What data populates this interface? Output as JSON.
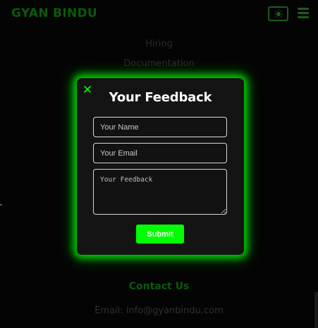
{
  "colors": {
    "accent": "#00ff00",
    "dim_accent": "#0a5a0a",
    "modal_bg": "#141414",
    "page_bg": "#040404"
  },
  "header": {
    "logo_text": "GYAN BINDU",
    "theme_toggle_icon": "sun-icon",
    "menu_icon": "hamburger-icon"
  },
  "nav": {
    "items": [
      "Hiring",
      "Documentation"
    ]
  },
  "modal": {
    "close_icon": "close-icon",
    "close_symbol": "✕",
    "title": "Your Feedback",
    "name_placeholder": "Your Name",
    "email_placeholder": "Your Email",
    "feedback_placeholder": "Your Feedback",
    "submit_label": "Submit"
  },
  "contact": {
    "title": "Contact Us",
    "email": "Email: info@gyanbindu.com"
  }
}
